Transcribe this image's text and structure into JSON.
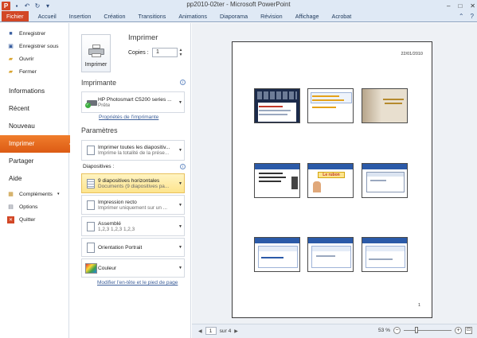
{
  "window": {
    "title": "pp2010-02ter  -  Microsoft PowerPoint",
    "app_icon_letter": "P",
    "controls": [
      "–",
      "□",
      "✕"
    ]
  },
  "ribbon": {
    "tabs": [
      "Fichier",
      "Accueil",
      "Insertion",
      "Création",
      "Transitions",
      "Animations",
      "Diaporama",
      "Révision",
      "Affichage",
      "Acrobat"
    ]
  },
  "nav": {
    "save": "Enregistrer",
    "save_as": "Enregistrer sous",
    "open": "Ouvrir",
    "close": "Fermer",
    "info": "Informations",
    "recent": "Récent",
    "new": "Nouveau",
    "print": "Imprimer",
    "share": "Partager",
    "help": "Aide",
    "addins": "Compléments",
    "options": "Options",
    "exit": "Quitter"
  },
  "print_panel": {
    "title": "Imprimer",
    "button_label": "Imprimer",
    "copies_label": "Copies :",
    "copies_value": "1",
    "printer_heading": "Imprimante",
    "printer_name": "HP Photosmart C5200 series ...",
    "printer_status": "Prête",
    "printer_properties_link": "Propriétés de l'imprimante",
    "settings_heading": "Paramètres",
    "slides_label": "Diapositives :",
    "settings": [
      {
        "l1": "Imprimer toutes les diapositiv...",
        "l2": "Imprime la totalité de la prése..."
      },
      {
        "l1": "9 diapositives horizontales",
        "l2": "Documents (9 diapositives pa..."
      },
      {
        "l1": "Impression recto",
        "l2": "Imprimer uniquement sur un ..."
      },
      {
        "l1": "Assemblé",
        "l2": "1,2,3    1,2,3    1,2,3"
      },
      {
        "l1": "Orientation Portrait",
        "l2": ""
      },
      {
        "l1": "Couleur",
        "l2": ""
      }
    ],
    "header_footer_link": "Modifier l'en-tête et le pied de page"
  },
  "preview": {
    "date": "22/01/2010",
    "page_number": "1",
    "current_page": "1",
    "total_pages": "sur 4",
    "zoom": "53 %",
    "zoom_fraction": 0.53,
    "thumb_slide_texts": [
      "Le rubon"
    ]
  },
  "colors": {
    "file_tab": "#d24726",
    "active_nav": "#e8671b",
    "ribbon_bg": "#dfe9f5",
    "highlight_select": "#fde48d"
  }
}
